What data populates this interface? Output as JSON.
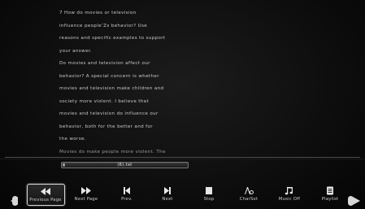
{
  "reader": {
    "lines": [
      "7  How do movies or television",
      "influence people’Zs behavior? Use",
      "reasons and specific examples to support",
      "your answer.",
      "Do movies and television affect our",
      "behavior? A special concern is whether",
      "movies and television make children and",
      "society more violent. I believe that",
      "movies and television do influence our",
      "behavior, both for the better and for",
      "the worse.",
      "Movies do make people more violent. The"
    ]
  },
  "progress": {
    "label": "(6).txt",
    "fraction": 0.02
  },
  "toolbar": {
    "buttons": [
      {
        "id": "previous-page",
        "label": "Previous Page",
        "icon": "fast-backward-icon",
        "selected": true
      },
      {
        "id": "next-page",
        "label": "Next Page",
        "icon": "fast-forward-icon",
        "selected": false
      },
      {
        "id": "prev",
        "label": "Prev.",
        "icon": "skip-back-icon",
        "selected": false
      },
      {
        "id": "next",
        "label": "Next",
        "icon": "skip-forward-icon",
        "selected": false
      },
      {
        "id": "stop",
        "label": "Stop",
        "icon": "stop-icon",
        "selected": false
      },
      {
        "id": "charset",
        "label": "CharSet",
        "icon": "charset-icon",
        "selected": false
      },
      {
        "id": "music-off",
        "label": "Music Off",
        "icon": "music-note-icon",
        "selected": false
      },
      {
        "id": "playlist",
        "label": "Playlist",
        "icon": "playlist-icon",
        "selected": false
      }
    ]
  },
  "colors": {
    "background": "#0b0b0b",
    "text": "#c9c9c9",
    "accent": "#d8d8d8"
  }
}
